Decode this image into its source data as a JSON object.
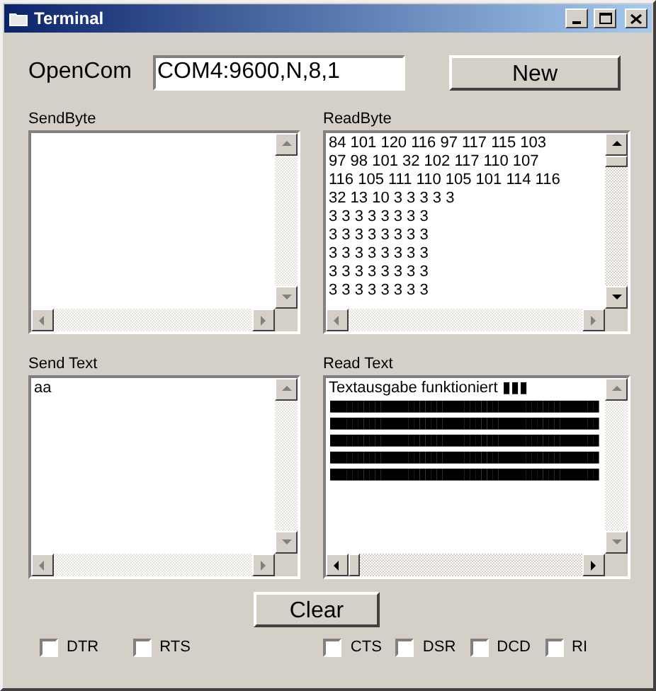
{
  "window": {
    "title": "Terminal"
  },
  "open_com": {
    "label": "OpenCom",
    "value": "COM4:9600,N,8,1"
  },
  "new_button": "New",
  "panels": [
    {
      "label": "SendByte",
      "vscroll_disabled": true,
      "hscroll_disabled": true
    },
    {
      "label": "ReadByte",
      "lines": [
        "84 101 120 116 97 117 115 103",
        "97 98 101 32 102 117 110 107",
        "116 105 111 110 105 101 114 116",
        "32 13 10 3 3 3 3 3",
        "3 3 3 3 3 3 3 3",
        "3 3 3 3 3 3 3 3",
        "3 3 3 3 3 3 3 3",
        "3 3 3 3 3 3 3 3",
        "3 3 3 3 3 3 3 3"
      ],
      "vscroll_disabled": false,
      "hscroll_disabled": true
    },
    {
      "label": "Send Text",
      "lines": [
        "aa"
      ],
      "vscroll_disabled": true,
      "hscroll_disabled": true
    },
    {
      "label": "Read Text",
      "lines": [
        "Textausgabe funktioniert ▮▮▮",
        "▮▮▮▮▮▮▮▮▮▮▮▮▮▮▮▮▮▮▮▮▮▮▮▮▮▮▮▮▮▮▮▮▮▮▮▮▮▮▮▮▮▮▮▮▮▮▮▮",
        "▮▮▮▮▮▮▮▮▮▮▮▮▮▮▮▮▮▮▮▮▮▮▮▮▮▮▮▮▮▮▮▮▮▮▮▮▮▮▮▮▮▮▮▮▮▮▮▮",
        "▮▮▮▮▮▮▮▮▮▮▮▮▮▮▮▮▮▮▮▮▮▮▮▮▮▮▮▮▮▮▮▮▮▮▮▮▮▮▮▮▮▮▮▮▮▮▮▮",
        "▮▮▮▮▮▮▮▮▮▮▮▮▮▮▮▮▮▮▮▮▮▮▮▮▮▮▮▮▮▮▮▮▮▮▮▮▮▮▮▮▮▮▮▮▮▮▮▮",
        "▮▮▮▮▮▮▮▮▮▮▮▮▮▮▮▮▮▮▮▮▮▮▮▮▮▮▮▮▮▮▮▮▮▮▮▮▮▮▮▮▮▮▮▮▮▮▮▮"
      ],
      "vscroll_disabled": true,
      "hscroll_disabled": false
    }
  ],
  "clear_button": "Clear",
  "checkboxes_left": [
    {
      "label": "DTR",
      "checked": false
    },
    {
      "label": "RTS",
      "checked": false
    }
  ],
  "checkboxes_right": [
    {
      "label": "CTS",
      "checked": false
    },
    {
      "label": "DSR",
      "checked": false
    },
    {
      "label": "DCD",
      "checked": false
    },
    {
      "label": "RI",
      "checked": false
    }
  ]
}
